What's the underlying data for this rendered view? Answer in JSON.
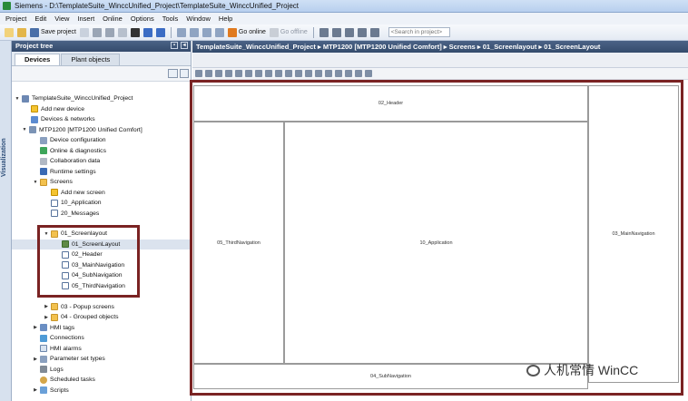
{
  "window": {
    "title": "Siemens - D:\\TemplateSuite_WinccUnified_Project\\TemplateSuite_WinccUnified_Project"
  },
  "menu": [
    "Project",
    "Edit",
    "View",
    "Insert",
    "Online",
    "Options",
    "Tools",
    "Window",
    "Help"
  ],
  "toolbar": {
    "save_label": "Save project",
    "go_online_label": "Go online",
    "go_offline_label": "Go offline",
    "search_placeholder": "<Search in project>"
  },
  "side_tab": {
    "label": "Visualization"
  },
  "project_tree": {
    "title": "Project tree",
    "tabs": [
      "Devices",
      "Plant objects"
    ],
    "items": [
      {
        "label": "TemplateSuite_WinccUnified_Project",
        "icon": "project-icon",
        "expanded": true
      },
      {
        "label": "Add new device",
        "icon": "add-icon"
      },
      {
        "label": "Devices & networks",
        "icon": "network-icon"
      },
      {
        "label": "MTP1200 [MTP1200 Unified Comfort]",
        "icon": "panel-icon",
        "expanded": true
      },
      {
        "label": "Device configuration",
        "icon": "config-icon"
      },
      {
        "label": "Online & diagnostics",
        "icon": "diagnostics-icon"
      },
      {
        "label": "Collaboration data",
        "icon": "collaboration-icon"
      },
      {
        "label": "Runtime settings",
        "icon": "runtime-icon"
      },
      {
        "label": "Screens",
        "icon": "folder-icon",
        "expanded": true
      },
      {
        "label": "Add new screen",
        "icon": "add-icon"
      },
      {
        "label": "10_Application",
        "icon": "screen-icon"
      },
      {
        "label": "20_Messages",
        "icon": "screen-icon"
      },
      {
        "label": "01_Screenlayout",
        "icon": "folder-icon",
        "expanded": true
      },
      {
        "label": "01_ScreenLayout",
        "icon": "screen-layout-icon",
        "selected": true
      },
      {
        "label": "02_Header",
        "icon": "screen-icon"
      },
      {
        "label": "03_MainNavigation",
        "icon": "screen-icon"
      },
      {
        "label": "04_SubNavigation",
        "icon": "screen-icon"
      },
      {
        "label": "05_ThirdNavigation",
        "icon": "screen-icon"
      },
      {
        "label": "03 - Popup screens",
        "icon": "folder-icon",
        "expanded": false
      },
      {
        "label": "04 - Grouped objects",
        "icon": "folder-icon",
        "expanded": false
      },
      {
        "label": "HMI tags",
        "icon": "tags-icon",
        "expanded": false
      },
      {
        "label": "Connections",
        "icon": "connections-icon"
      },
      {
        "label": "HMI alarms",
        "icon": "alarms-icon"
      },
      {
        "label": "Parameter set types",
        "icon": "parameter-icon",
        "expanded": false
      },
      {
        "label": "Logs",
        "icon": "logs-icon"
      },
      {
        "label": "Scheduled tasks",
        "icon": "clock-icon"
      },
      {
        "label": "Scripts",
        "icon": "scripts-icon",
        "expanded": false
      }
    ]
  },
  "breadcrumb": {
    "text": "TemplateSuite_WinccUnified_Project  ▸  MTP1200 [MTP1200 Unified Comfort]  ▸  Screens  ▸  01_Screenlayout  ▸  01_ScreenLayout"
  },
  "canvas": {
    "regions": {
      "header": "02_Header",
      "main_navigation": "03_MainNavigation",
      "third_navigation": "05_ThirdNavigation",
      "application": "10_Application",
      "sub_navigation": "04_SubNavigation"
    }
  },
  "watermark": {
    "text": "人机常情 WinCC"
  },
  "colors": {
    "highlight": "#7a2323",
    "header_bar": "#3f5678"
  }
}
